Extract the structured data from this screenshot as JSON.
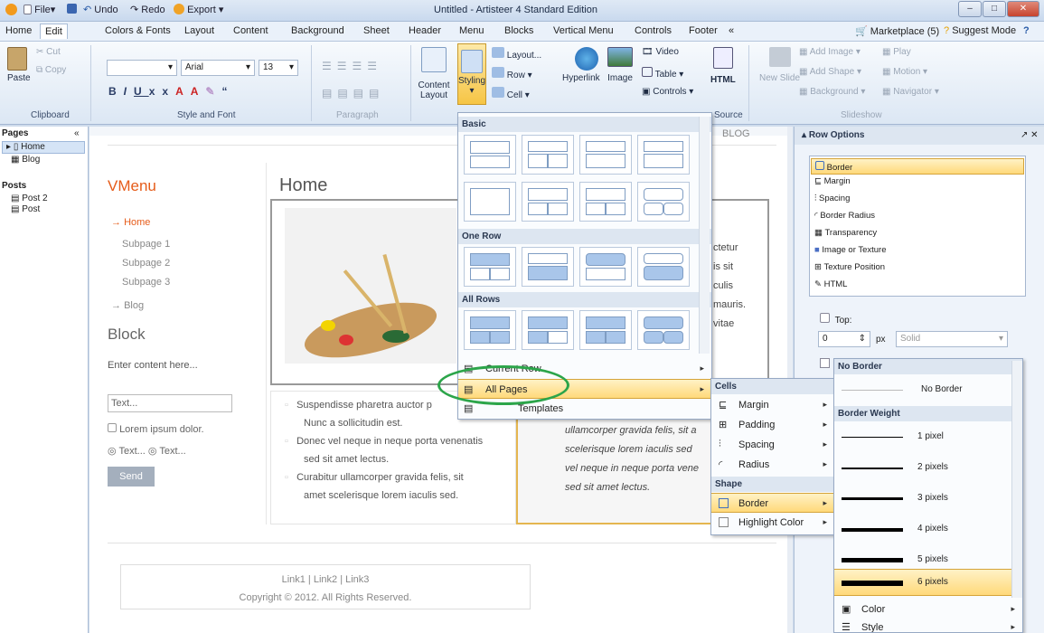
{
  "window": {
    "title": "Untitled - Artisteer 4 Standard Edition"
  },
  "quick_access": {
    "file": "File",
    "undo": "Undo",
    "redo": "Redo",
    "export": "Export"
  },
  "menubar": {
    "items": [
      "Home",
      "Edit",
      "Colors & Fonts",
      "Layout",
      "Content",
      "Background",
      "Sheet",
      "Header",
      "Menu",
      "Blocks",
      "Vertical Menu",
      "Controls",
      "Footer",
      "«"
    ],
    "marketplace": "Marketplace (5)",
    "suggest": "Suggest Mode"
  },
  "ribbon": {
    "clipboard": {
      "cut": "Cut",
      "copy": "Copy",
      "paste": "Paste",
      "label": "Clipboard"
    },
    "style_font": {
      "font": "Arial",
      "size": "13",
      "label": "Style and Font"
    },
    "paragraph": {
      "label": "Paragraph"
    },
    "content_layout": "Content Layout",
    "styling": "Styling",
    "layout_btn": "Layout...",
    "row": "Row",
    "cell": "Cell",
    "hyperlink": "Hyperlink",
    "image": "Image",
    "video": "Video",
    "table": "Table",
    "controls": "Controls",
    "html": "HTML",
    "source": "Source",
    "new_slide": "New Slide",
    "add_image": "Add Image",
    "play": "Play",
    "add_shape": "Add Shape",
    "motion": "Motion",
    "background": "Background",
    "navigator": "Navigator",
    "slideshow": "Slideshow"
  },
  "pages": {
    "header": "Pages",
    "collapse": "«",
    "items": [
      "Home",
      "Blog"
    ],
    "posts_header": "Posts",
    "posts": [
      "Post 2",
      "Post"
    ]
  },
  "canvas": {
    "blog_link": "BLOG",
    "vmenu_title": "VMenu",
    "vmenu": [
      "Home",
      "Subpage 1",
      "Subpage 2",
      "Subpage 3",
      "Blog"
    ],
    "block_title": "Block",
    "block_text": "Enter content here...",
    "text_input": "Text...",
    "checkbox": "Lorem ipsum dolor.",
    "radio1": "Text...",
    "radio2": "Text...",
    "send": "Send",
    "page_title": "Home",
    "right_text": [
      "ctetur",
      "is sit",
      "culis",
      "mauris.",
      "vitae"
    ],
    "bullets": [
      "Suspendisse pharetra auctor p",
      "Nunc a sollicitudin est.",
      "Donec vel neque in neque porta venenatis",
      "sed sit amet lectus.",
      "Curabitur ullamcorper gravida felis, sit",
      "amet scelerisque lorem iaculis sed."
    ],
    "italic": [
      "ullamcorper gravida felis, sit a",
      "scelerisque lorem iaculis sed",
      "vel neque in neque porta vene",
      "sed sit amet lectus."
    ],
    "footer_links": "Link1 | Link2 | Link3",
    "copyright": "Copyright © 2012. All Rights Reserved."
  },
  "styling_menu": {
    "basic": "Basic",
    "one_row": "One Row",
    "all_rows": "All Rows",
    "current_row": "Current Row",
    "all_pages": "All Pages",
    "templates": "Templates"
  },
  "cells_menu": {
    "cells": "Cells",
    "margin": "Margin",
    "padding": "Padding",
    "spacing": "Spacing",
    "radius": "Radius",
    "shape": "Shape",
    "border": "Border",
    "highlight": "Highlight Color"
  },
  "border_menu": {
    "no_border_hdr": "No Border",
    "no_border": "No Border",
    "weight_hdr": "Border Weight",
    "weights": [
      "1 pixel",
      "2 pixels",
      "3 pixels",
      "4 pixels",
      "5 pixels",
      "6 pixels"
    ],
    "color": "Color",
    "style": "Style"
  },
  "row_options": {
    "title": "Row Options",
    "items": [
      "Border",
      "Margin",
      "Spacing",
      "Border Radius",
      "Transparency",
      "Image or Texture",
      "Texture Position",
      "HTML"
    ],
    "top": "Top:",
    "value": "0",
    "unit": "px",
    "style": "Solid"
  },
  "colors": {
    "accent": "#ff6a00",
    "highlight": "#ffd97a",
    "circle": "#2ca54a"
  }
}
